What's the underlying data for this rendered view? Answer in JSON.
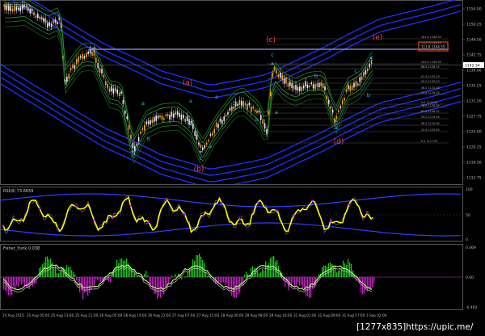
{
  "main_panel": {
    "symbol_label": "GBPUSD,M30",
    "price_axis": [
      "1154.00",
      "1150.25",
      "1146.50",
      "1142.75",
      "1139.00",
      "1135.25",
      "1131.50",
      "1127.75",
      "1124.00",
      "1120.25",
      "1116.50",
      "1112.75"
    ],
    "current_price": "1142.34",
    "boxed_level": "111.8 1144.55",
    "level_labels": [
      "161.8 1148.39",
      "150.0 1146.49",
      "100.0 1140.55",
      "88.6 1138.74",
      "61.8 1135.29",
      "50.0 1133.43",
      "38.2 1131.58",
      "23.6 1129.28",
      "0.0 1125.55",
      "78.6 1128.59",
      "61.8 1126.21",
      "50.0 1124.56",
      "38.2 1122.90",
      "23.6 1120.85",
      "0.0 1117.55"
    ],
    "wave_labels": [
      {
        "name": "a",
        "text": "(a)"
      },
      {
        "name": "b",
        "text": "(b)"
      },
      {
        "name": "c",
        "text": "(c)"
      },
      {
        "name": "d",
        "text": "(d)"
      },
      {
        "name": "e",
        "text": "(e)"
      }
    ],
    "sub_labels": [
      "a",
      "b",
      "c",
      "a",
      "b",
      "c",
      "a",
      "b",
      "c",
      "a",
      "b",
      "c",
      "a",
      "b",
      "c",
      "a",
      "b"
    ],
    "colors": {
      "candle_up": "#e8e8e8",
      "candle_down": "#f0a020",
      "wave_label": "#ff4040",
      "sub_label": "#20c0e0",
      "band": "#2030ff",
      "inner": "#208020",
      "arrow_line": "#8080c0"
    }
  },
  "rsi_panel": {
    "label": "RSI(8) 73.6659",
    "axis": [
      "100",
      "50",
      "0"
    ],
    "colors": {
      "line": "#ffff00",
      "aux": "#ff00ff",
      "band": "#2030ff"
    }
  },
  "fisher_panel": {
    "label": "Fisher_Yurik 0.038",
    "axis": [
      "0.469",
      "0.00",
      "-0.492"
    ],
    "colors": {
      "pos": "#20c020",
      "neg": "#c020c0",
      "line": "#c0ff80"
    }
  },
  "time_axis": [
    "24 Aug 2015",
    "25 Aug 05:00",
    "25 Aug 13:00",
    "25 Aug 21:00",
    "26 Aug 05:00",
    "26 Aug 14:00",
    "26 Aug 22:00",
    "27 Aug 07:00",
    "27 Aug 15:00",
    "28 Aug 00:00",
    "28 Aug 08:00",
    "28 Aug 16:00",
    "31 Aug 01:00",
    "31 Aug 09:00",
    "31 Aug 17:00",
    "1 Sep 02:00"
  ],
  "watermark": "[1277x835]https://upic.me/"
}
